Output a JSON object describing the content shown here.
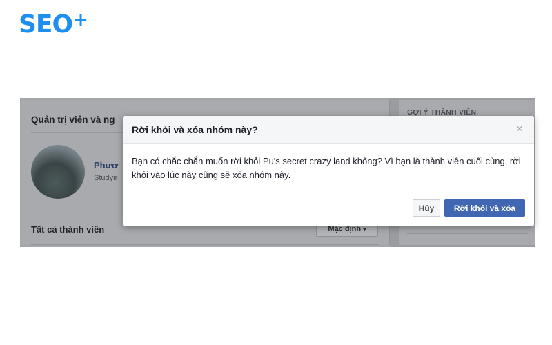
{
  "logo": {
    "text": "SEO",
    "plus": "+"
  },
  "background_page": {
    "admins_section_title": "Quản trị viên và ng",
    "member": {
      "name": "Phươ",
      "subtitle": "Studyir"
    },
    "all_members_title": "Tất cả thành viên",
    "sort_button": {
      "label": "Mặc định",
      "caret": "▾"
    },
    "suggest_title": "GỢI Ý THÀNH VIÊN"
  },
  "dialog": {
    "title": "Rời khỏi và xóa nhóm này?",
    "close_glyph": "×",
    "body": "Bạn có chắc chắn muốn rời khỏi Pu's secret crazy land không? Vì bạn là thành viên cuối cùng, rời khỏi vào lúc này cũng sẽ xóa nhóm này.",
    "cancel_label": "Hủy",
    "confirm_label": "Rời khỏi và xóa"
  },
  "colors": {
    "brand": "#1e8ff0",
    "primary_button": "#4267b2",
    "overlay": "#9c9ea2"
  }
}
